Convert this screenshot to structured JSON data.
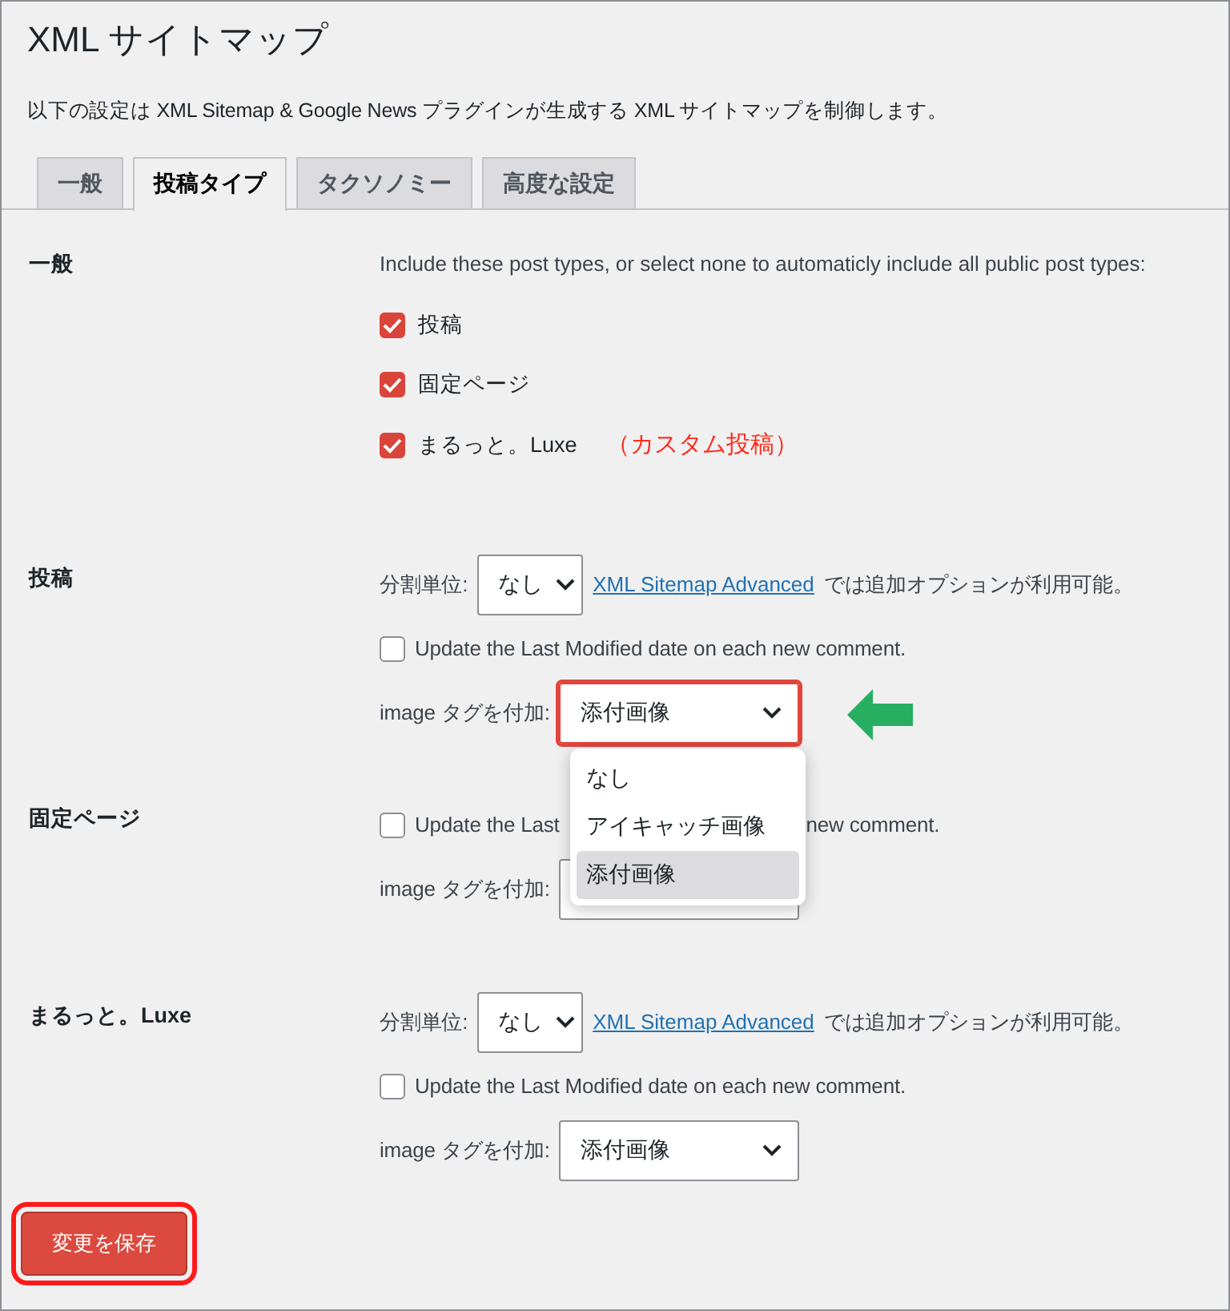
{
  "page": {
    "title": "XML サイトマップ",
    "description": "以下の設定は XML Sitemap & Google News プラグインが生成する XML サイトマップを制御します。"
  },
  "tabs": [
    {
      "label": "一般",
      "selected": false
    },
    {
      "label": "投稿タイプ",
      "selected": true
    },
    {
      "label": "タクソノミー",
      "selected": false
    },
    {
      "label": "高度な設定",
      "selected": false
    }
  ],
  "sections": [
    {
      "kind": "post_types",
      "label": "一般",
      "intro": "Include these post types, or select none to automaticly include all public post types:",
      "options": [
        {
          "label": "投稿",
          "checked": true
        },
        {
          "label": "固定ページ",
          "checked": true
        },
        {
          "label": "まるっと。Luxe",
          "checked": true,
          "note": "（カスタム投稿）"
        }
      ]
    },
    {
      "kind": "settings",
      "label": "投稿",
      "split_label": "分割単位:",
      "split_value": "なし",
      "advanced_link": "XML Sitemap Advanced",
      "advanced_note": "では追加オプションが利用可能。",
      "comment": {
        "label": "Update the Last Modified date on each new comment.",
        "checked": false
      },
      "image_label": "image タグを付加:",
      "image_value": "添付画像",
      "highlighted": true,
      "menu": [
        {
          "label": "なし",
          "selected": false
        },
        {
          "label": "アイキャッチ画像",
          "selected": false
        },
        {
          "label": "添付画像",
          "selected": true
        }
      ]
    },
    {
      "kind": "covered",
      "label": "固定ページ",
      "comment": {
        "label_start": "Update the Last",
        "label_end": "new comment.",
        "checked": false
      },
      "image_label": "image タグを付加:"
    },
    {
      "kind": "settings",
      "label": "まるっと。Luxe",
      "split_label": "分割単位:",
      "split_value": "なし",
      "advanced_link": "XML Sitemap Advanced",
      "advanced_note": "では追加オプションが利用可能。",
      "comment": {
        "label": "Update the Last Modified date on each new comment.",
        "checked": false
      },
      "image_label": "image タグを付加:",
      "image_value": "添付画像",
      "highlighted": false
    }
  ],
  "save_button": {
    "label": "変更を保存",
    "highlighted": true
  }
}
